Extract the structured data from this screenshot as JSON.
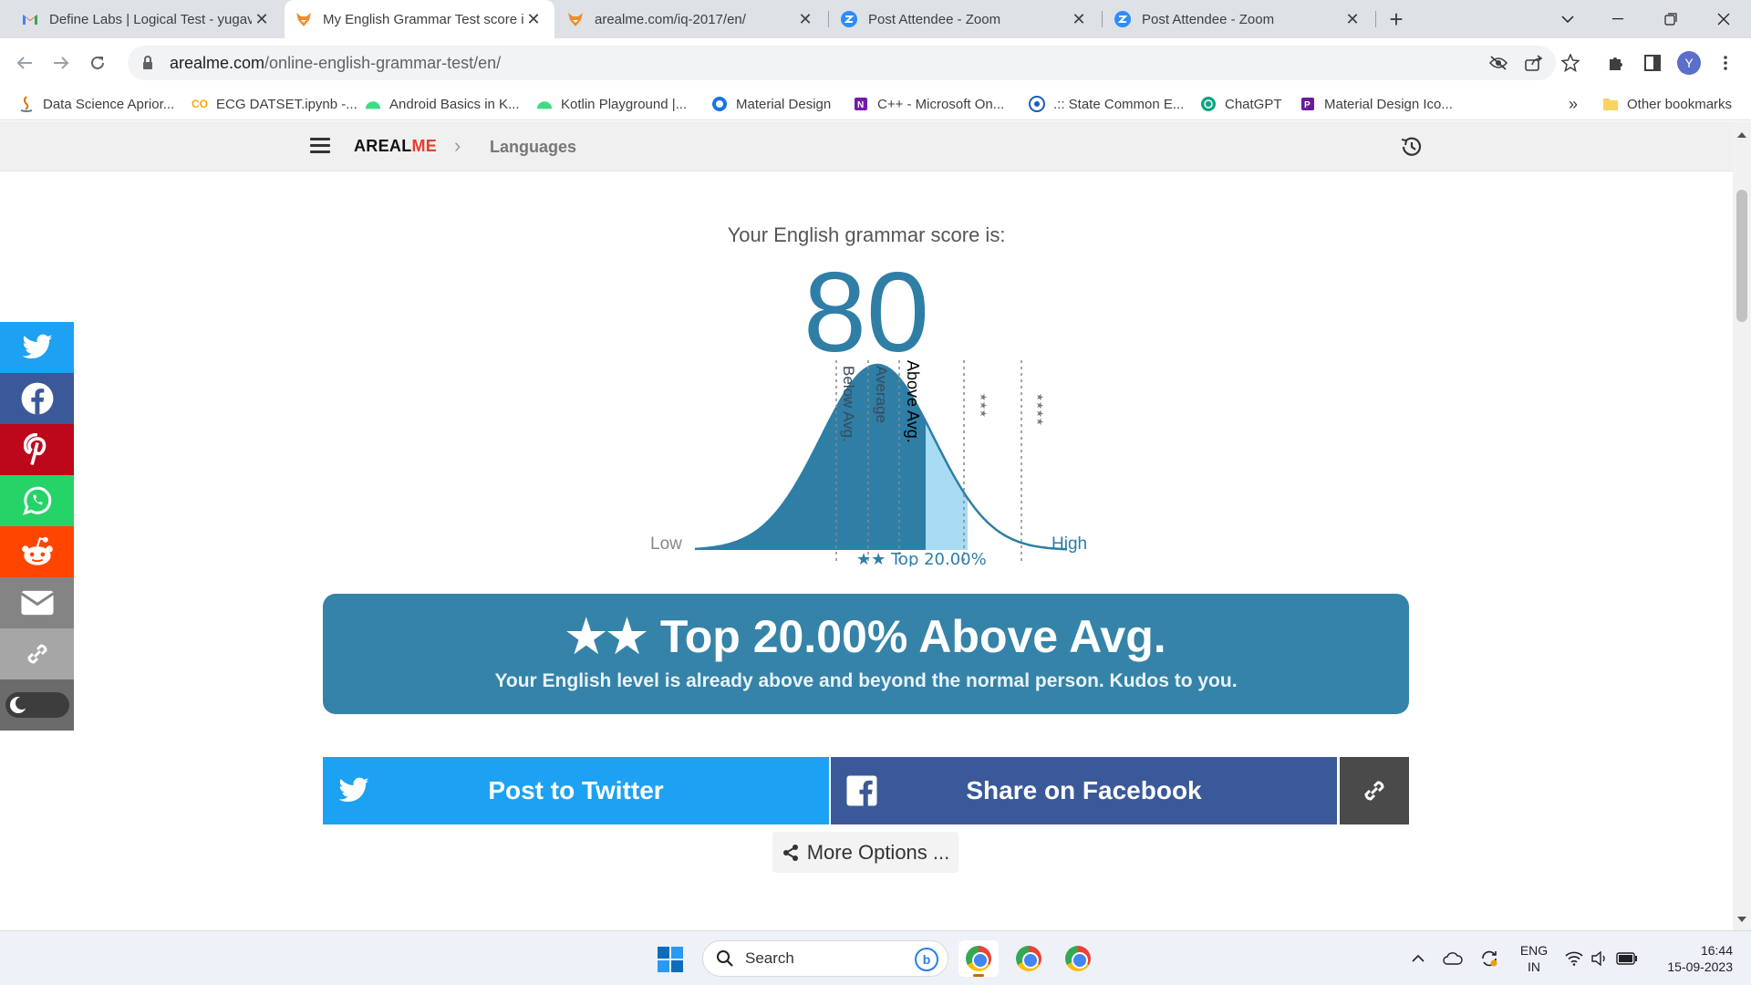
{
  "browser": {
    "tabs": [
      {
        "title": "Define Labs | Logical Test - yugav",
        "favicon": "gmail-icon",
        "active": false
      },
      {
        "title": "My English Grammar Test score is",
        "favicon": "arealme-fox-icon",
        "active": true
      },
      {
        "title": "arealme.com/iq-2017/en/",
        "favicon": "arealme-fox-icon",
        "active": false
      },
      {
        "title": "Post Attendee - Zoom",
        "favicon": "zoom-icon",
        "active": false
      },
      {
        "title": "Post Attendee - Zoom",
        "favicon": "zoom-icon",
        "active": false
      }
    ],
    "tab_close": "✕",
    "new_tab": "+",
    "address": {
      "host": "arealme.com",
      "path": "/online-english-grammar-test/en/"
    },
    "profile_initial": "Y",
    "bookmarks": [
      {
        "label": "Data Science Aprior...",
        "icon": "java-icon",
        "color": "#e76f00"
      },
      {
        "label": "ECG DATSET.ipynb -...",
        "icon": "colab-icon",
        "color": "#f9ab00"
      },
      {
        "label": "Android Basics in K...",
        "icon": "android-icon",
        "color": "#3ddc84"
      },
      {
        "label": "Kotlin Playground |...",
        "icon": "android-icon",
        "color": "#3ddc84"
      },
      {
        "label": "Material Design",
        "icon": "material-design-icon",
        "color": "#1a73e8"
      },
      {
        "label": "C++ - Microsoft On...",
        "icon": "onenote-icon",
        "color": "#7719aa"
      },
      {
        "label": ".:: State Common E...",
        "icon": "state-cet-icon",
        "color": "#1a5fb4"
      },
      {
        "label": "ChatGPT",
        "icon": "chatgpt-icon",
        "color": "#10a37f"
      },
      {
        "label": "Material Design Ico...",
        "icon": "material-icons-icon",
        "color": "#6a1b9a"
      }
    ],
    "bookmarks_overflow": "»",
    "other_bookmarks": "Other bookmarks"
  },
  "site": {
    "logo_part1": "AREAL",
    "logo_part2": "ME",
    "breadcrumb_sep": "›",
    "breadcrumb": "Languages"
  },
  "result": {
    "score_label": "Your English grammar score is:",
    "score": "80",
    "curve": {
      "low_label": "Low",
      "high_label": "High",
      "band_labels": [
        "Below Avg.",
        "Average",
        "Above Avg.",
        "★★★",
        "★★★★"
      ],
      "highlighted_band": "Above Avg.",
      "marker_label": "★★ Top 20.00%"
    },
    "banner_title": "★★ Top 20.00% Above Avg.",
    "banner_subtitle": "Your English level is already above and beyond the normal person. Kudos to you."
  },
  "share": {
    "twitter_label": "Post to Twitter",
    "facebook_label": "Share on Facebook",
    "more_options": "More Options ..."
  },
  "social_rail": [
    {
      "name": "twitter-icon",
      "color": "#1da1f2"
    },
    {
      "name": "facebook-icon",
      "color": "#3b5998"
    },
    {
      "name": "pinterest-icon",
      "color": "#bd081c"
    },
    {
      "name": "whatsapp-icon",
      "color": "#25d366"
    },
    {
      "name": "reddit-icon",
      "color": "#ff4500"
    },
    {
      "name": "email-icon",
      "color": "#848484"
    },
    {
      "name": "link-icon",
      "color": "#a6a6a6"
    }
  ],
  "colors": {
    "accent": "#2e7ea6",
    "banner": "#3583a8",
    "curve_fill": "#2e7ea6",
    "curve_highlight": "#a8dcf5"
  },
  "taskbar": {
    "search_placeholder": "Search",
    "lang_line1": "ENG",
    "lang_line2": "IN",
    "time": "16:44",
    "date": "15-09-2023"
  }
}
